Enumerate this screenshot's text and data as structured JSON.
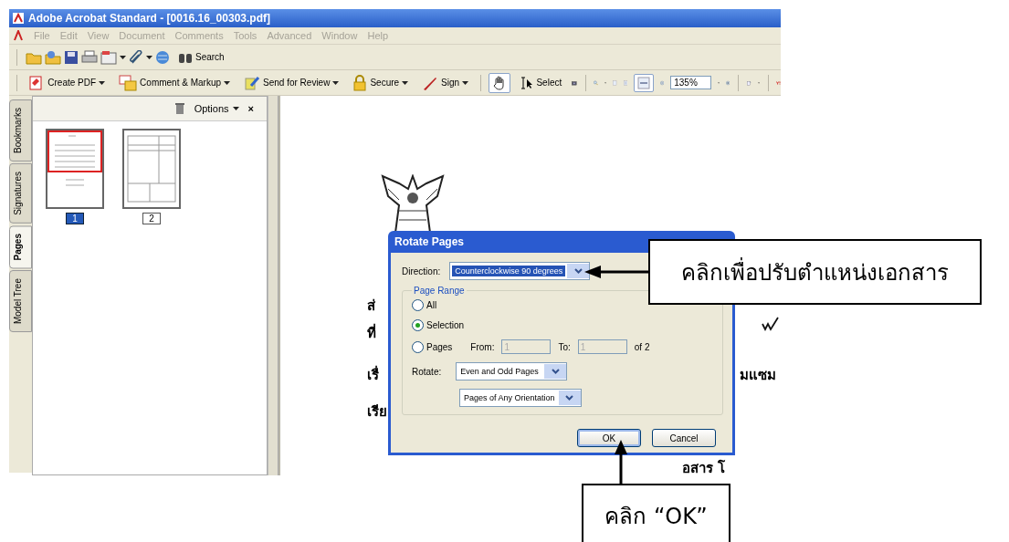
{
  "window": {
    "title": "Adobe Acrobat Standard - [0016.16_00303.pdf]"
  },
  "menu": [
    {
      "label": "File",
      "disabled": true
    },
    {
      "label": "Edit",
      "disabled": true
    },
    {
      "label": "View",
      "disabled": true
    },
    {
      "label": "Document",
      "disabled": true
    },
    {
      "label": "Comments",
      "disabled": true
    },
    {
      "label": "Tools",
      "disabled": true
    },
    {
      "label": "Advanced",
      "disabled": true
    },
    {
      "label": "Window",
      "disabled": true
    },
    {
      "label": "Help",
      "disabled": true
    }
  ],
  "file_toolbar": {
    "search_label": "Search"
  },
  "tasks_toolbar": [
    {
      "label": "Create PDF",
      "has_menu": true
    },
    {
      "label": "Comment & Markup",
      "has_menu": true
    },
    {
      "label": "Send for Review",
      "has_menu": true
    },
    {
      "label": "Secure",
      "has_menu": true
    },
    {
      "label": "Sign",
      "has_menu": true
    }
  ],
  "tools": {
    "hand_selected": true,
    "select_label": "Select",
    "fit_width_selected": true,
    "zoom_value": "135%"
  },
  "side_tabs": [
    {
      "label": "Bookmarks",
      "selected": false
    },
    {
      "label": "Signatures",
      "selected": false
    },
    {
      "label": "Pages",
      "selected": true
    },
    {
      "label": "Model Tree",
      "selected": false
    }
  ],
  "pages_panel": {
    "options_label": "Options",
    "close_label": "×",
    "thumbnails": [
      {
        "label": "1",
        "selected": true
      },
      {
        "label": "2",
        "selected": false
      }
    ]
  },
  "document_text": [
    "ส่",
    "ที่",
    "เรื่",
    "เรีย",
    "มแซม",
    "อสาร โ"
  ],
  "dialog": {
    "title": "Rotate Pages",
    "direction_label": "Direction:",
    "direction_value": "Counterclockwise 90 degrees",
    "page_range_label": "Page Range",
    "range_options": [
      {
        "label": "All",
        "selected": false
      },
      {
        "label": "Selection",
        "selected": true
      },
      {
        "label": "Pages",
        "selected": false
      }
    ],
    "from_label": "From:",
    "from_value": "1",
    "to_label": "To:",
    "to_value": "1",
    "of_label": "of 2",
    "page_fields_disabled": true,
    "rotate_label": "Rotate:",
    "rotate_value": "Even and Odd Pages",
    "orientation_value": "Pages of Any Orientation",
    "buttons": [
      {
        "label": "OK",
        "default": true
      },
      {
        "label": "Cancel",
        "default": false
      }
    ]
  },
  "callouts": [
    {
      "text": "คลิกเพื่อปรับตำแหน่งเอกสาร"
    },
    {
      "text": "คลิก “OK”"
    }
  ]
}
